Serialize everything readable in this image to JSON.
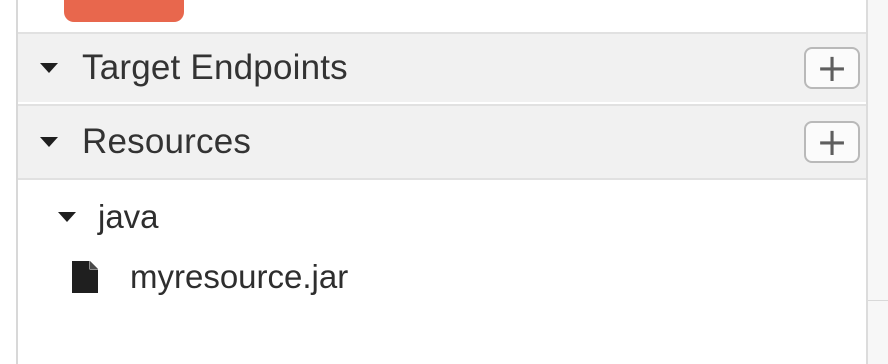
{
  "sections": [
    {
      "label": "Target Endpoints",
      "add_button_label": "+"
    },
    {
      "label": "Resources",
      "add_button_label": "+"
    }
  ],
  "tree": {
    "folder": {
      "label": "java",
      "expanded": true
    },
    "files": [
      {
        "label": "myresource.jar",
        "icon": "file-icon"
      }
    ]
  },
  "colors": {
    "accent": "#e8674d",
    "header_bg": "#f1f1f1",
    "text": "#333333"
  }
}
